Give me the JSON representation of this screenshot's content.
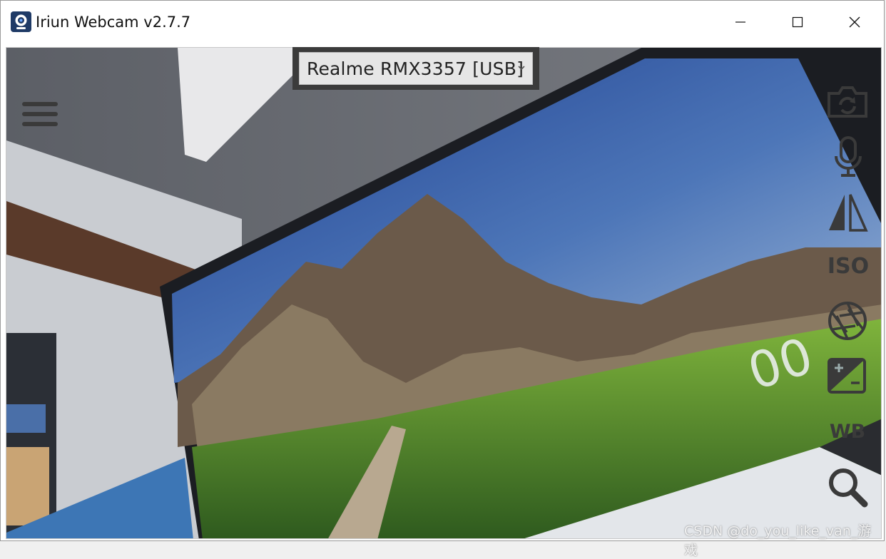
{
  "window": {
    "title": "Iriun Webcam v2.7.7",
    "caption_buttons": [
      "minimize-icon",
      "maximize-icon",
      "close-icon"
    ]
  },
  "device_select": {
    "selected": "Realme RMX3357 [USB]"
  },
  "toolbar": {
    "menu_icon": "hamburger-menu-icon",
    "tools": [
      {
        "icon": "switch-camera-icon"
      },
      {
        "icon": "microphone-icon"
      },
      {
        "icon": "mirror-flip-icon"
      },
      {
        "label": "ISO"
      },
      {
        "icon": "aperture-icon"
      },
      {
        "icon": "exposure-icon"
      },
      {
        "label": "WB"
      },
      {
        "icon": "zoom-icon"
      }
    ]
  },
  "watermark": {
    "text": "CSDN @do_you_like_van_游戏"
  },
  "colors": {
    "overlay_icon": "#3a3a3a",
    "select_frame": "#3b3b3b",
    "select_bg": "#e6e6e6"
  }
}
